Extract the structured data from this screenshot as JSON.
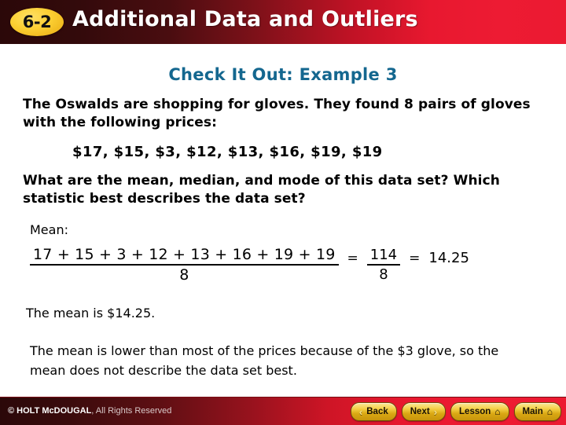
{
  "header": {
    "badge": "6-2",
    "title": "Additional Data and Outliers"
  },
  "slide": {
    "example_title": "Check It Out: Example 3",
    "prompt_1": "The Oswalds are shopping for gloves. They found 8 pairs of gloves with the following prices:",
    "price_list": "$17, $15, $3, $12, $13, $16, $19, $19",
    "prompt_2": "What are the mean, median, and mode of this data set? Which statistic best describes the data set?",
    "mean_label": "Mean:",
    "equation": {
      "numerator": "17 + 15 + 3 + 12 + 13 + 16 + 19 + 19",
      "denominator": "8",
      "equals_1": "=",
      "simplified_numerator": "114",
      "simplified_denominator": "8",
      "equals_2": "=",
      "result": "14.25"
    },
    "mean_result": "The mean is $14.25.",
    "conclusion": "The mean is lower than most of the prices because of the $3 glove, so the mean does not describe the data set best."
  },
  "footer": {
    "copyright_strong": "© HOLT McDOUGAL",
    "copyright_light": ", All Rights Reserved",
    "buttons": [
      {
        "label": "Back",
        "chevron_left": "‹",
        "chevron_right": "",
        "home": ""
      },
      {
        "label": "Next",
        "chevron_left": "",
        "chevron_right": "›",
        "home": ""
      },
      {
        "label": "Lesson",
        "chevron_left": "",
        "chevron_right": "",
        "home": "⌂"
      },
      {
        "label": "Main",
        "chevron_left": "",
        "chevron_right": "",
        "home": "⌂"
      }
    ]
  },
  "colors": {
    "header_dark": "#2b0809",
    "header_red": "#ec1a31",
    "badge_gold": "#fcd034",
    "title_blue": "#14678f",
    "button_gold": "#f4cf45"
  }
}
